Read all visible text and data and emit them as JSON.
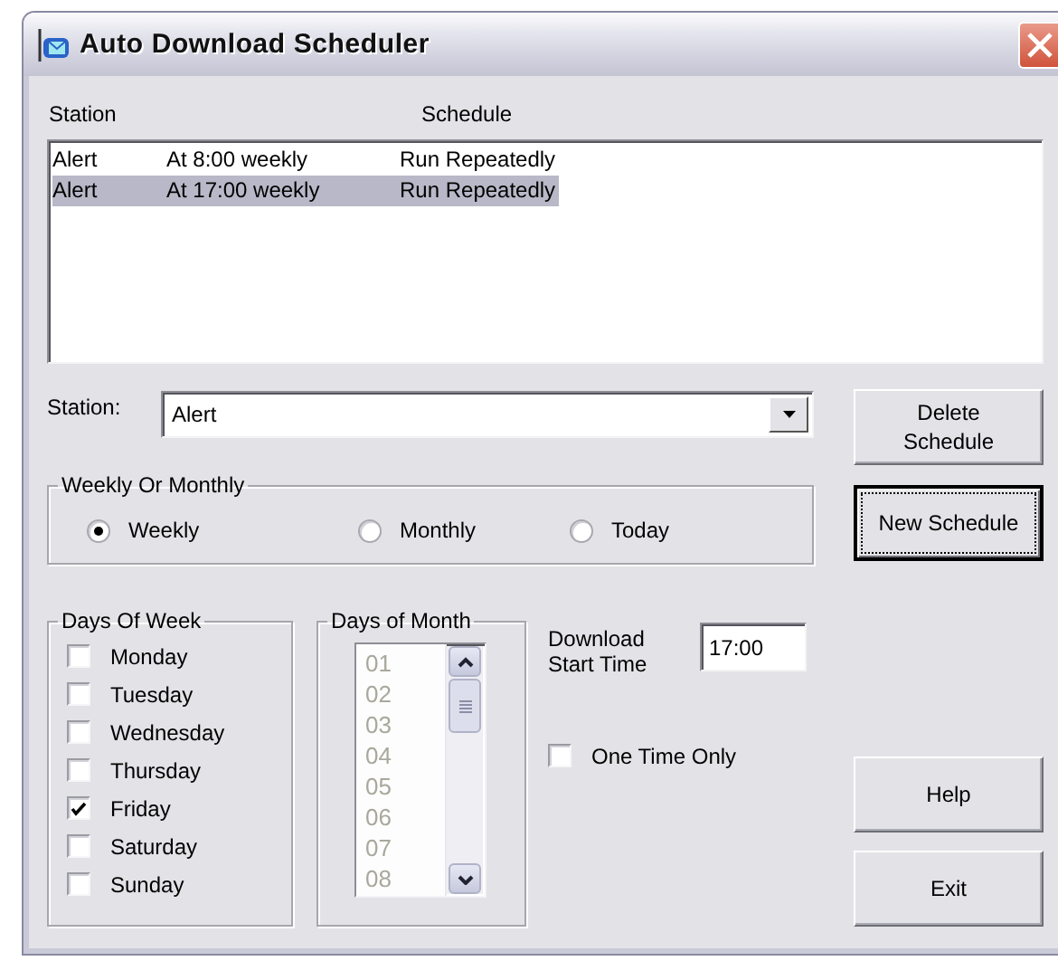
{
  "window": {
    "title": "Auto Download Scheduler"
  },
  "schedule_list": {
    "heading_labels": [
      "Station",
      "Schedule"
    ],
    "entries": [
      {
        "cells": [
          "Alert",
          "At 8:00 weekly",
          "Run Repeatedly"
        ],
        "selected": false
      },
      {
        "cells": [
          "Alert",
          "At 17:00 weekly",
          "Run Repeatedly"
        ],
        "selected": true
      }
    ]
  },
  "station": {
    "label": "Station:",
    "value": "Alert"
  },
  "weekly_or_monthly": {
    "title": "Weekly Or Monthly",
    "options": [
      {
        "label": "Weekly",
        "selected": true
      },
      {
        "label": "Monthly",
        "selected": false
      },
      {
        "label": "Today",
        "selected": false
      }
    ]
  },
  "days_of_week": {
    "title": "Days Of Week",
    "days": [
      {
        "label": "Monday",
        "checked": false
      },
      {
        "label": "Tuesday",
        "checked": false
      },
      {
        "label": "Wednesday",
        "checked": false
      },
      {
        "label": "Thursday",
        "checked": false
      },
      {
        "label": "Friday",
        "checked": true
      },
      {
        "label": "Saturday",
        "checked": false
      },
      {
        "label": "Sunday",
        "checked": false
      }
    ]
  },
  "days_of_month": {
    "title": "Days of Month",
    "disabled": true,
    "items": [
      "01",
      "02",
      "03",
      "04",
      "05",
      "06",
      "07",
      "08"
    ]
  },
  "download_start_time": {
    "label": "Download Start Time",
    "value": "17:00"
  },
  "one_time_only": {
    "label": "One Time Only",
    "checked": false
  },
  "side_buttons": [
    {
      "label": "Delete Schedule",
      "default": false
    },
    {
      "label": "New Schedule",
      "default": true
    }
  ],
  "bottom_buttons": [
    {
      "label": "Help",
      "default": false
    },
    {
      "label": "Exit",
      "default": false
    }
  ]
}
